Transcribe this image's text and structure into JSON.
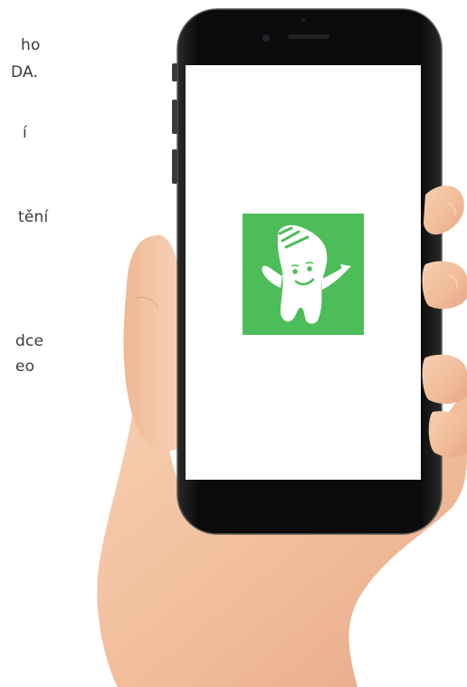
{
  "clipped_text": {
    "line_1": "ho",
    "line_2": "DA.",
    "line_3": "í",
    "line_4": "tění",
    "line_5": "dce",
    "line_6": "eo"
  },
  "colors": {
    "app_icon_bg": "#4cbd58",
    "mascot": "#ffffff",
    "phone_body": "#0d0d0d",
    "screen": "#ffffff",
    "skin": "#f2c1a0"
  },
  "icons": {
    "app_icon": "skoda-mascot-app-icon"
  }
}
